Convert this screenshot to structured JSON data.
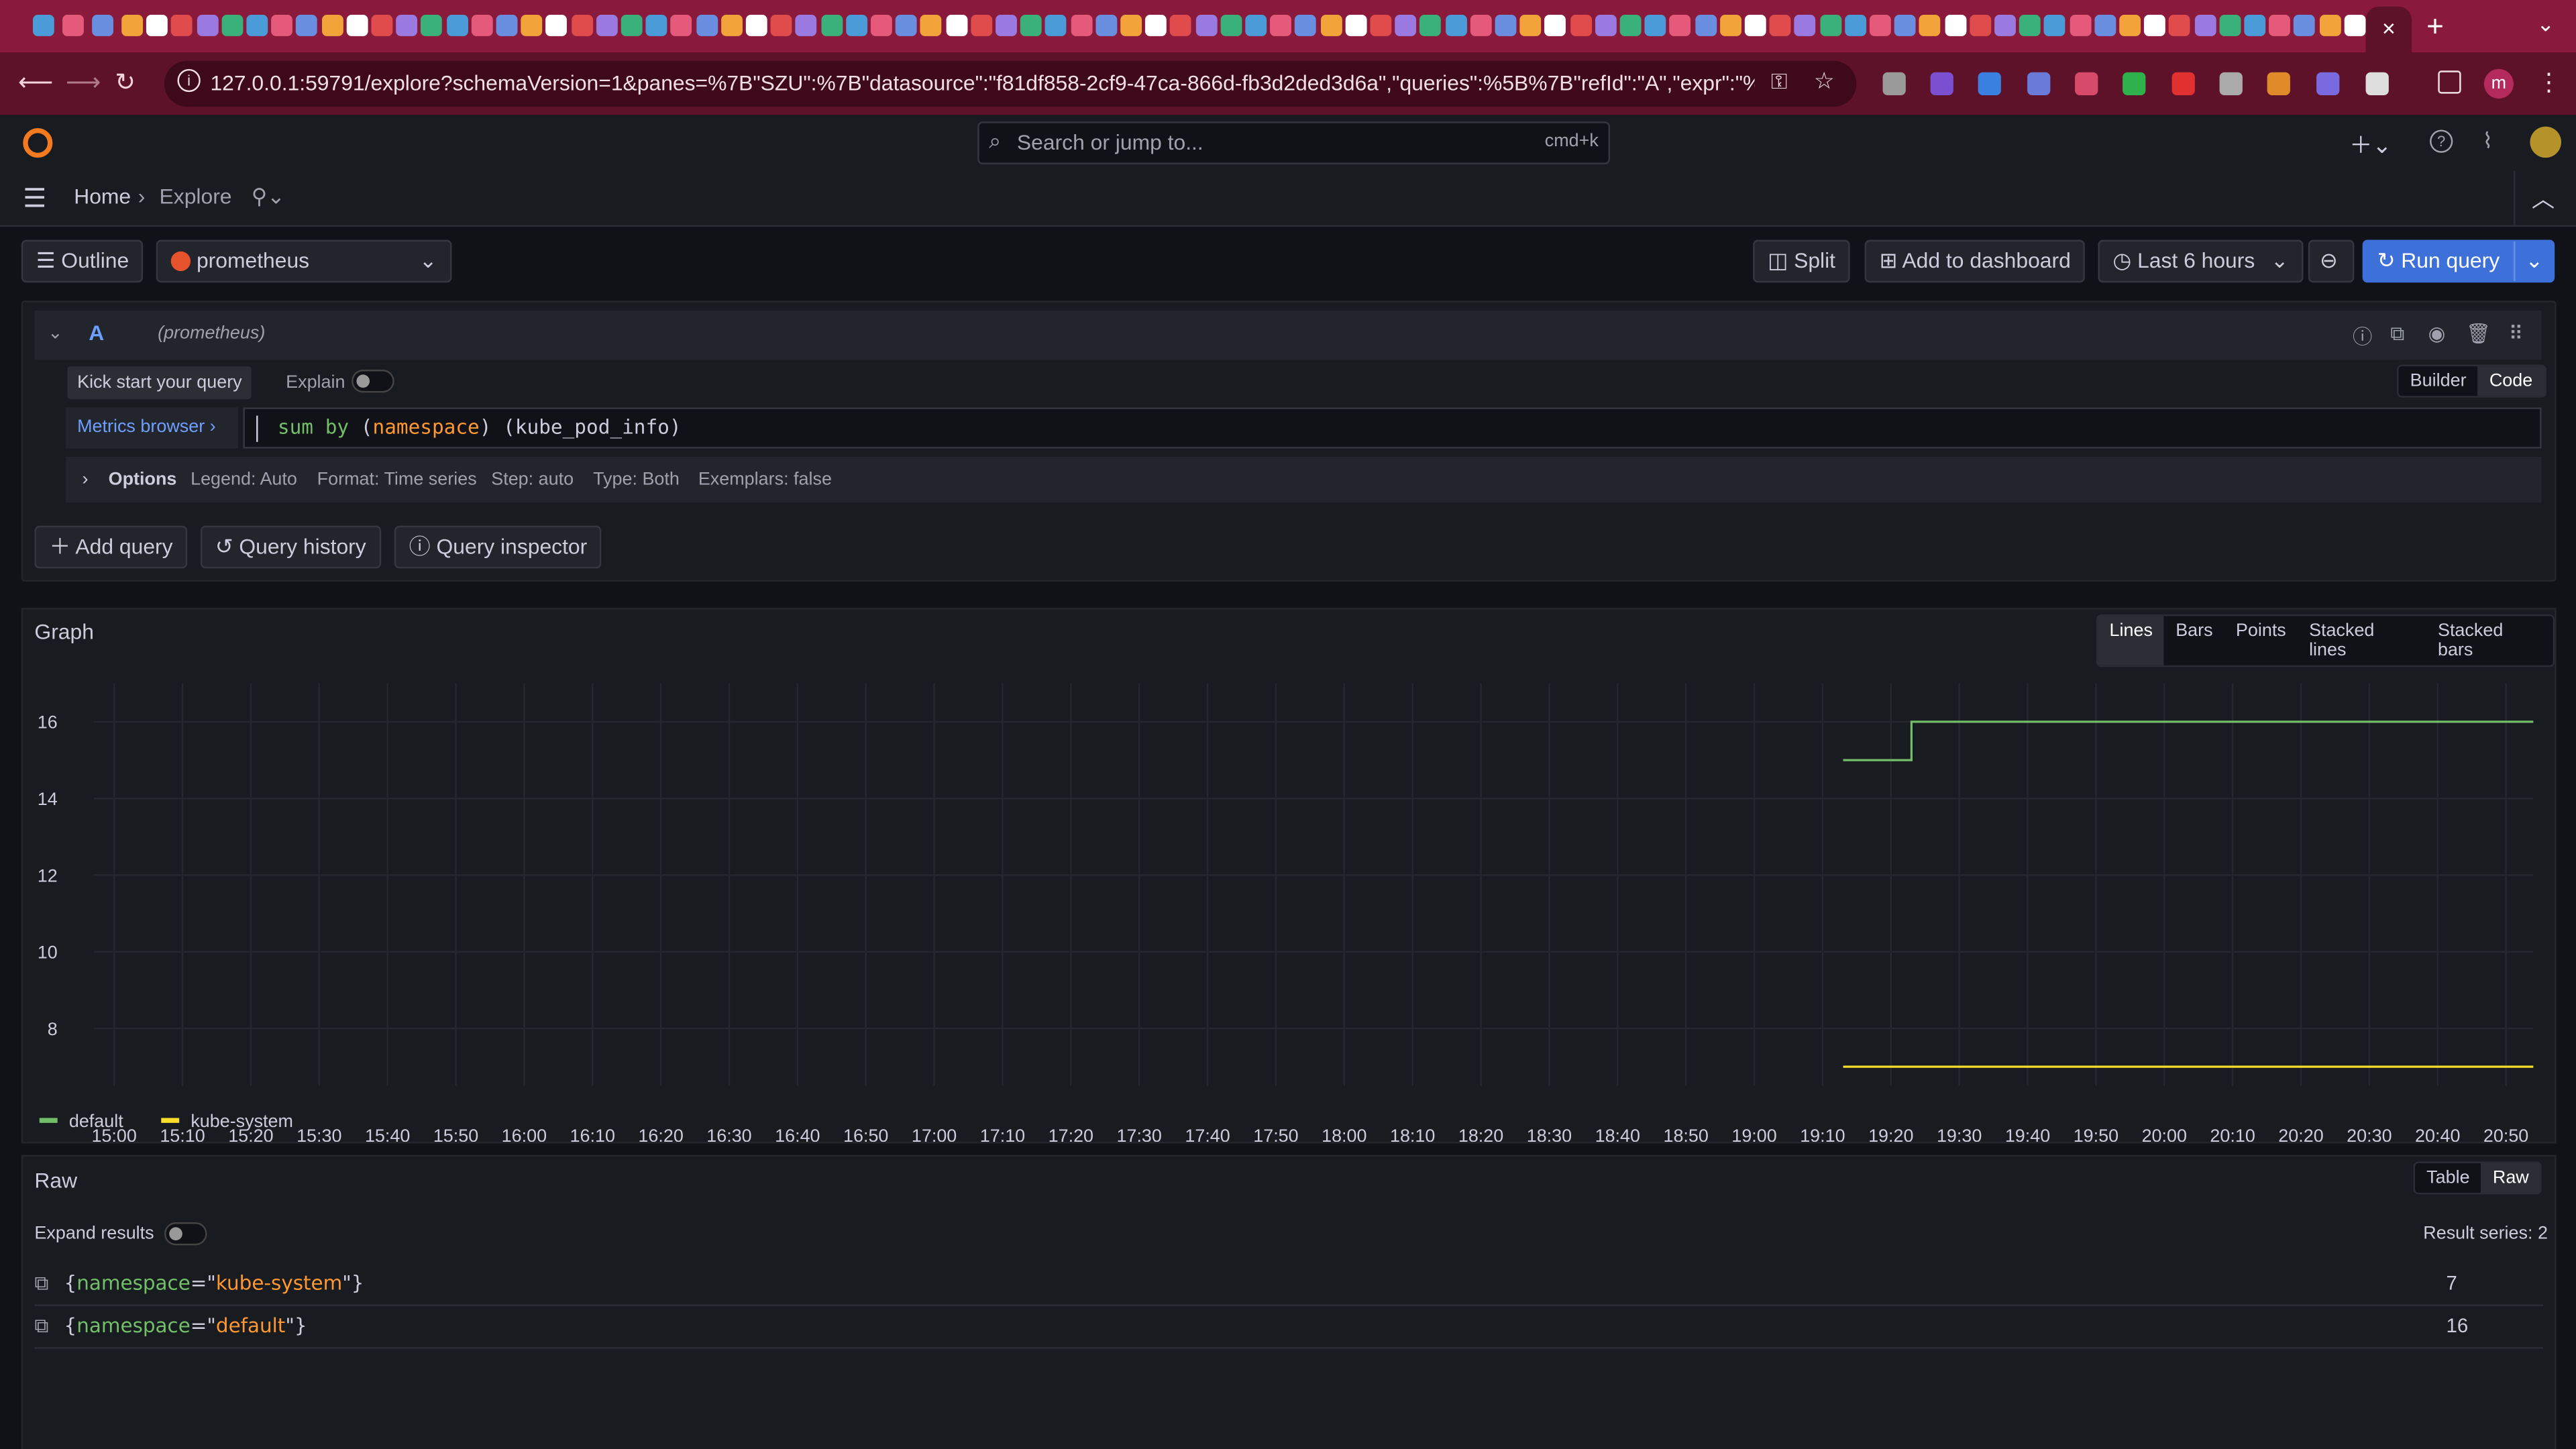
{
  "browser": {
    "url": "127.0.0.1:59791/explore?schemaVersion=1&panes=%7B\"SZU\":%7B\"datasource\":\"f81df858-2cf9-47ca-866d-fb3d2ded3d6a\",\"queries\":%5B%7B\"refId\":\"A\",\"expr\":\"%20%2...",
    "profile_initial": "m",
    "close_tab": "×",
    "new_tab": "+",
    "tab_search": "⌄"
  },
  "grafana": {
    "search_placeholder": "Search or jump to...",
    "search_shortcut": "cmd+k",
    "breadcrumb": [
      "Home",
      "Explore"
    ],
    "breadcrumb_sep": "›"
  },
  "explore_toolbar": {
    "outline": "Outline",
    "datasource": "prometheus",
    "split": "Split",
    "add_to_dashboard": "Add to dashboard",
    "time_range": "Last 6 hours",
    "run_query": "Run query"
  },
  "query": {
    "ref_id": "A",
    "datasource_hint": "(prometheus)",
    "kick_start": "Kick start your query",
    "explain": "Explain",
    "builder": "Builder",
    "code": "Code",
    "metrics_browser": "Metrics browser ›",
    "expr_tokens": [
      {
        "t": "sum",
        "c": "#73bf69"
      },
      {
        "t": " ",
        "c": "#ccccdc"
      },
      {
        "t": "by",
        "c": "#73bf69"
      },
      {
        "t": " (",
        "c": "#ccccdc"
      },
      {
        "t": "namespace",
        "c": "#ff9830"
      },
      {
        "t": ") (kube_pod_info)",
        "c": "#ccccdc"
      }
    ],
    "options_label": "Options",
    "options": [
      "Legend: Auto",
      "Format: Time series",
      "Step: auto",
      "Type: Both",
      "Exemplars: false"
    ],
    "add_query": "Add query",
    "query_history": "Query history",
    "query_inspector": "Query inspector"
  },
  "graph": {
    "title": "Graph",
    "modes": [
      "Lines",
      "Bars",
      "Points",
      "Stacked lines",
      "Stacked bars"
    ],
    "active_mode": "Lines"
  },
  "raw": {
    "title": "Raw",
    "views": [
      "Table",
      "Raw"
    ],
    "active_view": "Raw",
    "expand_results": "Expand results",
    "result_series": "Result series: 2",
    "rows": [
      {
        "key": "namespace",
        "value": "kube-system",
        "result": "7"
      },
      {
        "key": "namespace",
        "value": "default",
        "result": "16"
      }
    ]
  },
  "chart_data": {
    "type": "line",
    "x_ticks": [
      "15:00",
      "15:10",
      "15:20",
      "15:30",
      "15:40",
      "15:50",
      "16:00",
      "16:10",
      "16:20",
      "16:30",
      "16:40",
      "16:50",
      "17:00",
      "17:10",
      "17:20",
      "17:30",
      "17:40",
      "17:50",
      "18:00",
      "18:10",
      "18:20",
      "18:30",
      "18:40",
      "18:50",
      "19:00",
      "19:10",
      "19:20",
      "19:30",
      "19:40",
      "19:50",
      "20:00",
      "20:10",
      "20:20",
      "20:30",
      "20:40",
      "20:50"
    ],
    "y_ticks": [
      8,
      10,
      12,
      14,
      16
    ],
    "ylim": [
      6.5,
      17
    ],
    "xlim": [
      "14:57",
      "20:54"
    ],
    "grid": true,
    "legend_position": "bottom-left",
    "series": [
      {
        "name": "default",
        "color": "#73bf69",
        "points": [
          [
            "19:13",
            15
          ],
          [
            "19:23",
            15
          ],
          [
            "19:23",
            16
          ],
          [
            "20:54",
            16
          ]
        ]
      },
      {
        "name": "kube-system",
        "color": "#fade2a",
        "points": [
          [
            "19:13",
            7
          ],
          [
            "20:54",
            7
          ]
        ]
      }
    ]
  }
}
